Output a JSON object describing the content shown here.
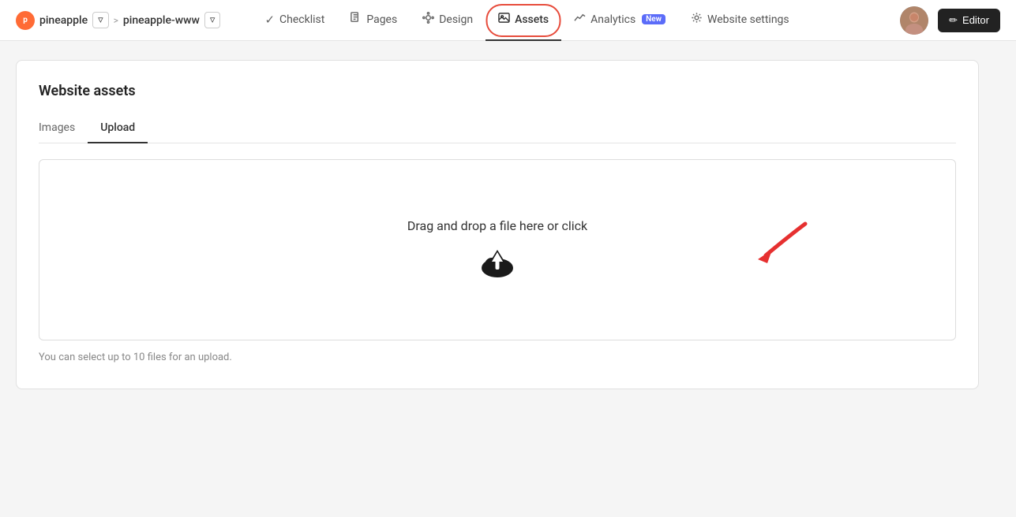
{
  "breadcrumb": {
    "logo_text": "p",
    "app_name": "pineapple",
    "separator": ">",
    "project_name": "pineapple-www"
  },
  "nav": {
    "tabs": [
      {
        "id": "checklist",
        "label": "Checklist",
        "icon": "check",
        "active": false
      },
      {
        "id": "pages",
        "label": "Pages",
        "icon": "pages",
        "active": false
      },
      {
        "id": "design",
        "label": "Design",
        "icon": "design",
        "active": false
      },
      {
        "id": "assets",
        "label": "Assets",
        "icon": "image",
        "active": true
      },
      {
        "id": "analytics",
        "label": "Analytics",
        "icon": "analytics",
        "active": false,
        "badge": "New"
      },
      {
        "id": "website-settings",
        "label": "Website settings",
        "icon": "settings",
        "active": false
      }
    ],
    "editor_button": "Editor"
  },
  "main": {
    "card_title": "Website assets",
    "inner_tabs": [
      {
        "id": "images",
        "label": "Images",
        "active": false
      },
      {
        "id": "upload",
        "label": "Upload",
        "active": true
      }
    ],
    "upload_area": {
      "drag_text": "Drag and drop a file here or click",
      "helper_text": "You can select up to 10 files for an upload."
    }
  }
}
